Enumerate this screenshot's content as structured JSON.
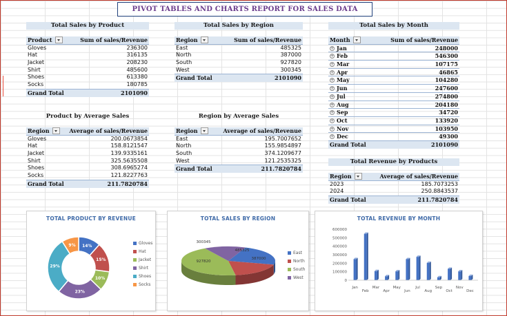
{
  "title": "PIVOT TABLES AND CHARTS REPORT FOR SALES DATA",
  "sales_by_product": {
    "heading": "Total Sales by Product",
    "col1": "Product",
    "col2": "Sum of sales/Revenue",
    "rows": [
      [
        "Gloves",
        "236300"
      ],
      [
        "Hat",
        "316135"
      ],
      [
        "Jacket",
        "208230"
      ],
      [
        "Shirt",
        "485600"
      ],
      [
        "Shoes",
        "613380"
      ],
      [
        "Socks",
        "180785"
      ]
    ],
    "total_label": "Grand Total",
    "total": "2101090"
  },
  "sales_by_region": {
    "heading": "Total Sales by Region",
    "col1": "Region",
    "col2": "Sum of sales/Revenue",
    "rows": [
      [
        "East",
        "485325"
      ],
      [
        "North",
        "387000"
      ],
      [
        "South",
        "927820"
      ],
      [
        "West",
        "300345"
      ]
    ],
    "total_label": "Grand Total",
    "total": "2101090"
  },
  "sales_by_month": {
    "heading": "Total Sales by Month",
    "col1": "Month",
    "col2": "Sum of sales/Revenue",
    "rows": [
      [
        "Jan",
        "248000"
      ],
      [
        "Feb",
        "546300"
      ],
      [
        "Mar",
        "107175"
      ],
      [
        "Apr",
        "46865"
      ],
      [
        "May",
        "104280"
      ],
      [
        "Jun",
        "247600"
      ],
      [
        "Jul",
        "274800"
      ],
      [
        "Aug",
        "204180"
      ],
      [
        "Sep",
        "34720"
      ],
      [
        "Oct",
        "133920"
      ],
      [
        "Nov",
        "103950"
      ],
      [
        "Dec",
        "49300"
      ]
    ],
    "total_label": "Grand Total",
    "total": "2101090"
  },
  "product_avg": {
    "heading": "Product by Average Sales",
    "col1": "Region",
    "col2": "Average of sales/Revenue",
    "rows": [
      [
        "Gloves",
        "200.0673854"
      ],
      [
        "Hat",
        "158.8121547"
      ],
      [
        "Jacket",
        "139.9335161"
      ],
      [
        "Shirt",
        "325.5635508"
      ],
      [
        "Shoes",
        "308.6965274"
      ],
      [
        "Socks",
        "121.8227763"
      ]
    ],
    "total_label": "Grand Total",
    "total": "211.7820784"
  },
  "region_avg": {
    "heading": "Region by Average Sales",
    "col1": "Region",
    "col2": "Average of sales/Revenue",
    "rows": [
      [
        "East",
        "195.7007652"
      ],
      [
        "North",
        "155.9854897"
      ],
      [
        "South",
        "374.1209677"
      ],
      [
        "West",
        "121.2535325"
      ]
    ],
    "total_label": "Grand Total",
    "total": "211.7820784"
  },
  "revenue_by_products": {
    "heading": "Total Revenue by Products",
    "col1": "Region",
    "col2": "Average of sales/Revenue",
    "rows": [
      [
        "2023",
        "185.7073253"
      ],
      [
        "2024",
        "250.8843537"
      ]
    ],
    "total_label": "Grand Total",
    "total": "211.7820784"
  },
  "colors": {
    "blue": "#4472c4",
    "red": "#c0504d",
    "green": "#9bbb59",
    "purple": "#8064a2",
    "aqua": "#4bacc6",
    "orange": "#f79646"
  },
  "chart_data": [
    {
      "type": "pie",
      "variant": "doughnut",
      "title": "TOTAL PRODUCT BY REVENUE",
      "categories": [
        "Gloves",
        "Hat",
        "Jacket",
        "Shirt",
        "Shoes",
        "Socks"
      ],
      "values": [
        236300,
        316135,
        208230,
        485600,
        613380,
        180785
      ],
      "labels": [
        "14%",
        "15%",
        "10%",
        "23%",
        "29%",
        "9%"
      ],
      "colors": [
        "#4472c4",
        "#c0504d",
        "#9bbb59",
        "#8064a2",
        "#4bacc6",
        "#f79646"
      ],
      "legend": "right"
    },
    {
      "type": "pie",
      "variant": "3d",
      "title": "TOTAL SALES BY REGION",
      "categories": [
        "East",
        "North",
        "South",
        "West"
      ],
      "values": [
        485325,
        387000,
        927820,
        300345
      ],
      "colors": [
        "#4472c4",
        "#c0504d",
        "#9bbb59",
        "#8064a2"
      ],
      "legend": "right"
    },
    {
      "type": "bar",
      "variant": "3d-column",
      "title": "TOTAL REVENUE BY MONTH",
      "categories": [
        "Jan",
        "Feb",
        "Mar",
        "Apr",
        "May",
        "Jun",
        "Jul",
        "Aug",
        "Sep",
        "Oct",
        "Nov",
        "Dec"
      ],
      "values": [
        248000,
        546300,
        107175,
        46865,
        104280,
        247600,
        274800,
        204180,
        34720,
        133920,
        103950,
        49300
      ],
      "yticks": [
        "0",
        "100000",
        "200000",
        "300000",
        "400000",
        "500000",
        "600000"
      ],
      "ylim": [
        0,
        600000
      ],
      "color": "#4472c4",
      "grid": false
    }
  ]
}
